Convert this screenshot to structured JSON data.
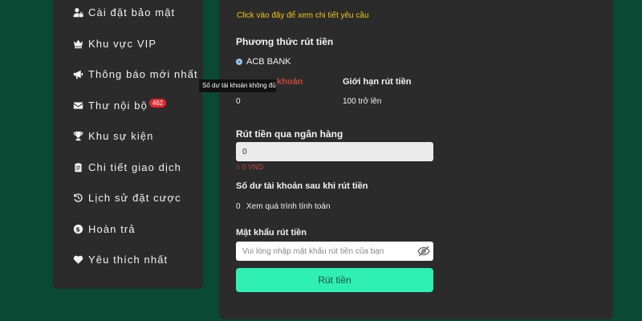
{
  "sidebar": {
    "items": [
      {
        "label": "Cài đặt bảo mật",
        "icon": "user-lock-icon"
      },
      {
        "label": "Khu vực VIP",
        "icon": "crown-icon"
      },
      {
        "label": "Thông báo mới nhất",
        "icon": "megaphone-icon"
      },
      {
        "label": "Thư nội bộ",
        "icon": "envelope-icon",
        "badge": "462"
      },
      {
        "label": "Khu sự kiện",
        "icon": "trophy-icon"
      },
      {
        "label": "Chi tiết giao dịch",
        "icon": "clipboard-icon"
      },
      {
        "label": "Lịch sử đặt cược",
        "icon": "history-icon"
      },
      {
        "label": "Hoàn trả",
        "icon": "dollar-circle-icon"
      },
      {
        "label": "Yêu thích nhất",
        "icon": "heart-icon"
      }
    ]
  },
  "withdraw": {
    "detail_link": "Click vào đây để xem chi tiết yêu cầu",
    "method_label": "Phương thức rút tiền",
    "method_option": "ACB BANK",
    "balance_label_visible": "khoản",
    "balance_value": "0",
    "limit_label": "Giới hạn rút tiền",
    "limit_value": "100 trở lên",
    "bank_label": "Rút tiền qua ngân hàng",
    "amount_value": "0",
    "amount_converted": "= 0 VND",
    "after_label": "Số dư tài khoản sau khi rút tiền",
    "after_value": "0",
    "after_link": "Xem quá trình tính toán",
    "password_label": "Mật khẩu rút tiền",
    "password_placeholder": "Vui lòng nhập mật khẩu rút tiền của bạn",
    "submit_label": "Rút tiền"
  },
  "tooltip": {
    "text": "Số dư tài khoản không đủ"
  },
  "colors": {
    "background": "#0a4a34",
    "panel": "#2b2b2b",
    "accent": "#2ff0b0",
    "badge": "#e3262b",
    "link": "#f0c419",
    "error": "#c8463c"
  }
}
